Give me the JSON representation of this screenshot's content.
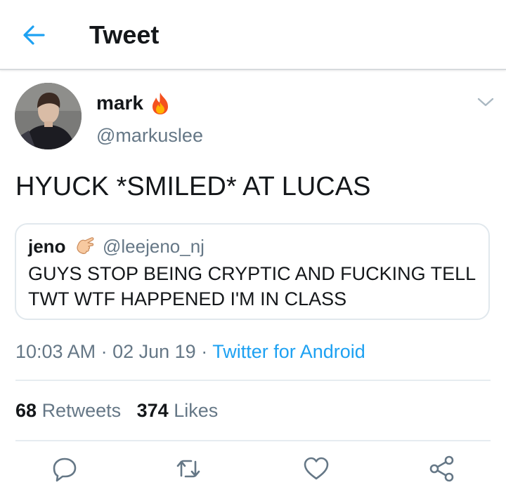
{
  "header": {
    "title": "Tweet"
  },
  "tweet": {
    "author_name": "mark",
    "author_handle": "@markuslee",
    "text": "HYUCK *SMILED* AT LUCAS",
    "time": "10:03 AM",
    "date": "02 Jun 19",
    "source": "Twitter for Android",
    "separator": " · "
  },
  "quoted": {
    "author_name": "jeno",
    "author_handle": "@leejeno_nj",
    "text": "GUYS STOP BEING CRYPTIC AND FUCKING TELL TWT WTF HAPPENED I'M IN CLASS"
  },
  "stats": {
    "retweets_count": "68",
    "retweets_label": "Retweets",
    "likes_count": "374",
    "likes_label": "Likes"
  },
  "icons": {
    "back": "arrow-left-icon",
    "author_emoji": "fire-icon",
    "quoted_emoji": "pointing-hand-icon",
    "menu": "chevron-down-icon",
    "actions": [
      "reply-icon",
      "retweet-icon",
      "like-icon",
      "share-icon"
    ]
  },
  "colors": {
    "accent": "#1da1f2",
    "secondary_text": "#657786",
    "divider": "#e6ecf0",
    "icon_gray": "#657786"
  }
}
